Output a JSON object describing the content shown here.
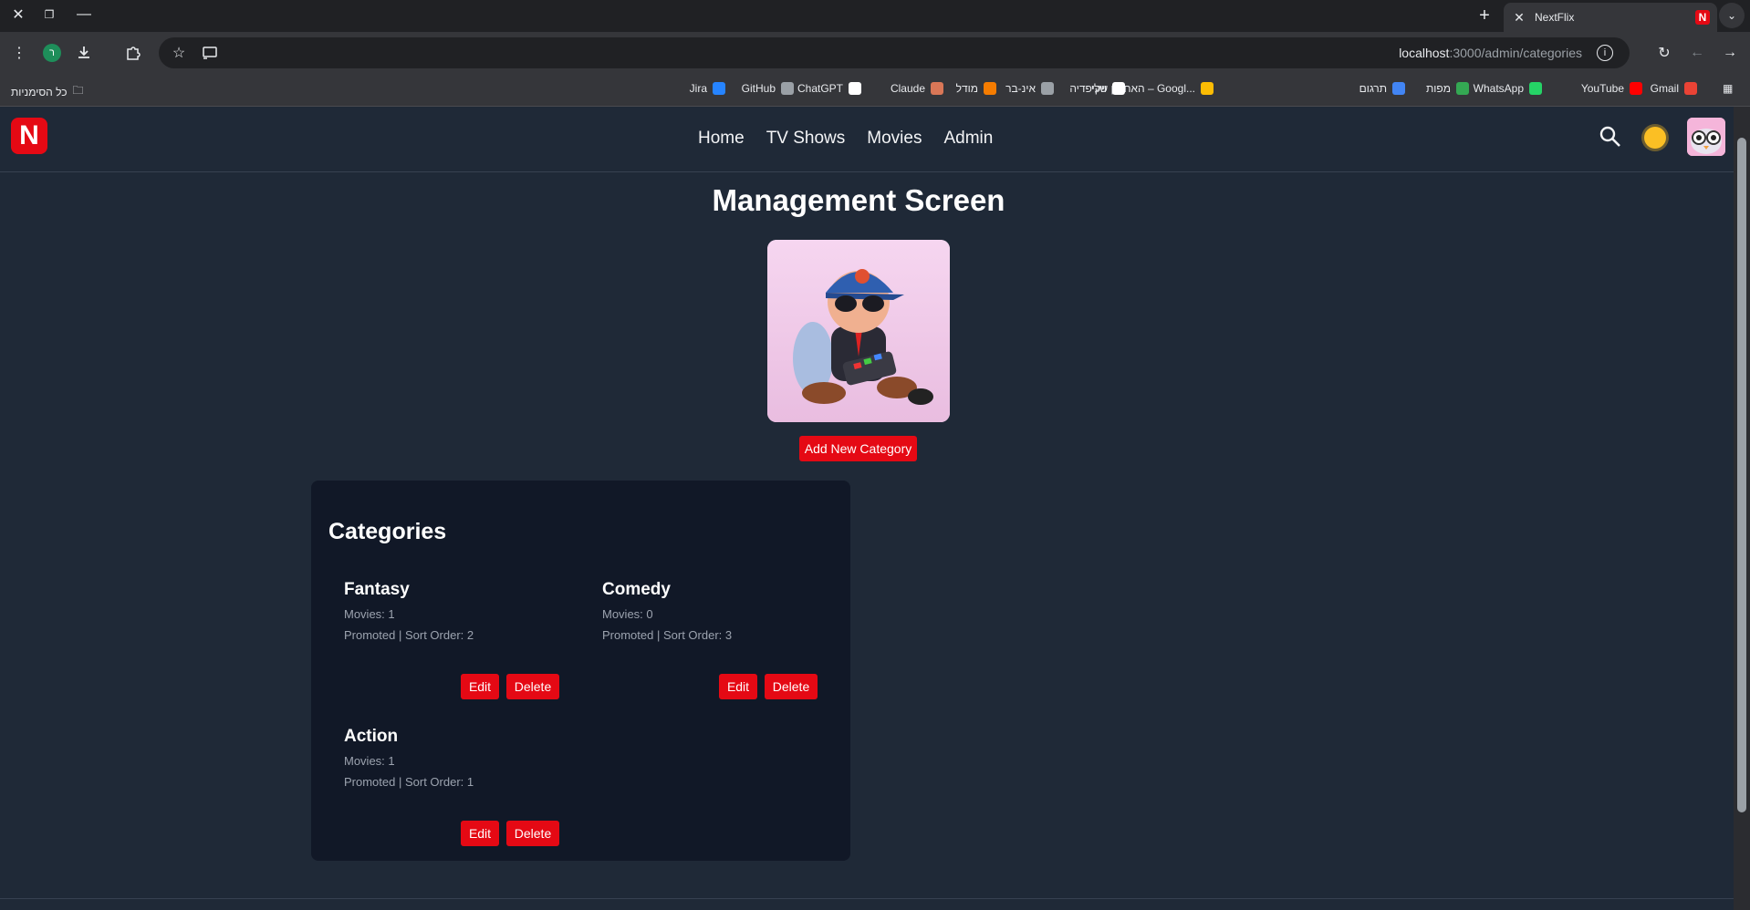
{
  "browser": {
    "tab_title": "NextFlix",
    "new_tab_label": "+",
    "url_host": "localhost",
    "url_rest": ":3000/admin/categories",
    "profile_initial": "ר",
    "favicon_letter": "N",
    "all_bookmarks_label": "כל הסימניות",
    "bookmarks": [
      {
        "label": "Gmail",
        "color": "#ea4335"
      },
      {
        "label": "YouTube",
        "color": "#ff0000"
      },
      {
        "label": "WhatsApp",
        "color": "#25d366"
      },
      {
        "label": "מפות",
        "color": "#34a853"
      },
      {
        "label": "תרגום",
        "color": "#4285f4"
      },
      {
        "label": "האחסון שלי – Googl...",
        "color": "#fbbc04"
      },
      {
        "label": "ויקיפדיה",
        "color": "#ffffff"
      },
      {
        "label": "אינ-בר",
        "color": "#9aa0a6"
      },
      {
        "label": "מודל",
        "color": "#f57c00"
      },
      {
        "label": "Claude",
        "color": "#d97757"
      },
      {
        "label": "ChatGPT",
        "color": "#ffffff"
      },
      {
        "label": "GitHub",
        "color": "#9aa0a6"
      },
      {
        "label": "Jira",
        "color": "#2684ff"
      }
    ]
  },
  "app": {
    "logo_letter": "N",
    "brand_color": "#e50914",
    "nav": {
      "home": "Home",
      "tv_shows": "TV Shows",
      "movies": "Movies",
      "admin": "Admin"
    },
    "page_title": "Management Screen",
    "add_button": "Add New Category",
    "panel_title": "Categories",
    "edit_label": "Edit",
    "delete_label": "Delete",
    "categories": [
      {
        "name": "Fantasy",
        "movies": "Movies: 1",
        "meta": "Promoted | Sort Order: 2"
      },
      {
        "name": "Comedy",
        "movies": "Movies: 0",
        "meta": "Promoted | Sort Order: 3"
      },
      {
        "name": "Action",
        "movies": "Movies: 1",
        "meta": "Promoted | Sort Order: 1"
      }
    ]
  }
}
